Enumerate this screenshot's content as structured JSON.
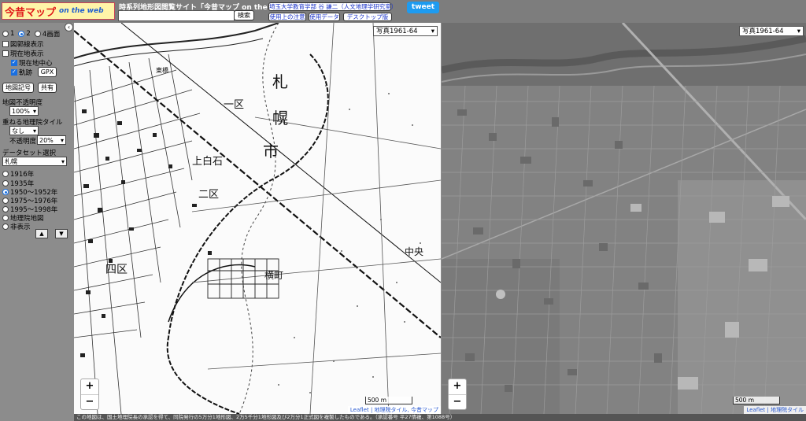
{
  "header": {
    "logo_jp": "今昔マップ",
    "logo_en": "on the web",
    "site_title": "時系列地形図閲覧サイト「今昔マップ on the web」",
    "search_value": "",
    "search_button": "検索",
    "links": [
      "埼玉大学教育学部 谷 謙二（人文地理学研究室）",
      "使用上の注意",
      "使用データ",
      "デスクトップ版"
    ],
    "tweet": "tweet"
  },
  "sidebar": {
    "screens": [
      {
        "label": "1",
        "selected": false
      },
      {
        "label": "2",
        "selected": true
      },
      {
        "label": "4画面",
        "selected": false
      }
    ],
    "boundary": "図郭線表示",
    "current_map": "現在地表示",
    "current_center": "現在地中心",
    "track": "軌跡",
    "gpx": "GPX",
    "map_code": "地図記号",
    "share": "共有",
    "opacity_label": "地図不透明度",
    "opacity_value": "100%",
    "overlay_label": "重ねる地理院タイル",
    "overlay_value": "なし",
    "overlay_opacity_label": "不透明度",
    "overlay_opacity_value": "20%",
    "dataset_label": "データセット選択",
    "dataset_value": "札幌",
    "periods": [
      {
        "label": "1916年",
        "selected": false
      },
      {
        "label": "1935年",
        "selected": false
      },
      {
        "label": "1950～1952年",
        "selected": true
      },
      {
        "label": "1975～1976年",
        "selected": false
      },
      {
        "label": "1995～1998年",
        "selected": false
      },
      {
        "label": "地理院地図",
        "selected": false
      },
      {
        "label": "非表示",
        "selected": false
      }
    ],
    "up_icon": "triangle-up-icon",
    "down_icon": "triangle-down-icon",
    "collapse_icon": "chevron-left-icon"
  },
  "map_left": {
    "layer_select": "写真1961-64",
    "scale": "500 m",
    "zoom_in": "+",
    "zoom_out": "−",
    "attribution": [
      "Leaflet",
      "地理院タイル",
      "今昔マップ"
    ],
    "labels": [
      "札",
      "幌",
      "市",
      "上白石",
      "二区",
      "一区",
      "中央",
      "横町",
      "四区",
      "東橋"
    ]
  },
  "map_right": {
    "layer_select": "写真1961-64",
    "scale": "500 m",
    "zoom_in": "+",
    "zoom_out": "−",
    "attribution": [
      "Leaflet",
      "地理院タイル"
    ]
  },
  "footer": "この地図は、国土地理院長の承認を得て、同院発行の5万分1地形図、2万5千分1地形図及び2万分1正式図を複製したものである。（承認番号 平27情複、第1088号）"
}
